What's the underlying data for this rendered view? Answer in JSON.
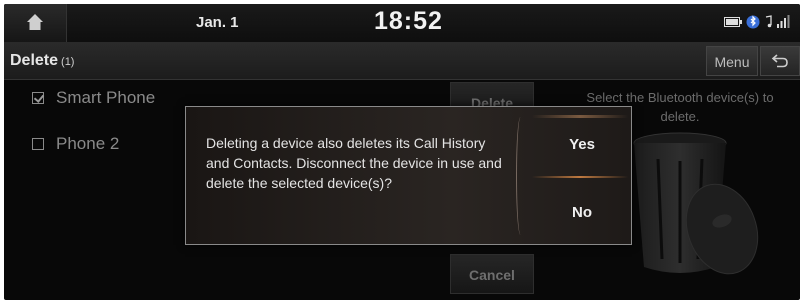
{
  "status": {
    "date": "Jan. 1",
    "time": "18:52"
  },
  "header": {
    "title": "Delete",
    "count": "(1)",
    "menu_label": "Menu"
  },
  "devices": [
    {
      "name": "Smart Phone",
      "checked": true
    },
    {
      "name": "Phone 2",
      "checked": false
    }
  ],
  "actions": {
    "delete_label": "Delete",
    "cancel_label": "Cancel"
  },
  "hint": "Select the Bluetooth device(s) to delete.",
  "dialog": {
    "message": "Deleting a device also deletes its Call History and Contacts. Disconnect the device in use and delete the selected device(s)?",
    "yes_label": "Yes",
    "no_label": "No"
  },
  "colors": {
    "accent": "#c07a40",
    "background": "#080808"
  }
}
